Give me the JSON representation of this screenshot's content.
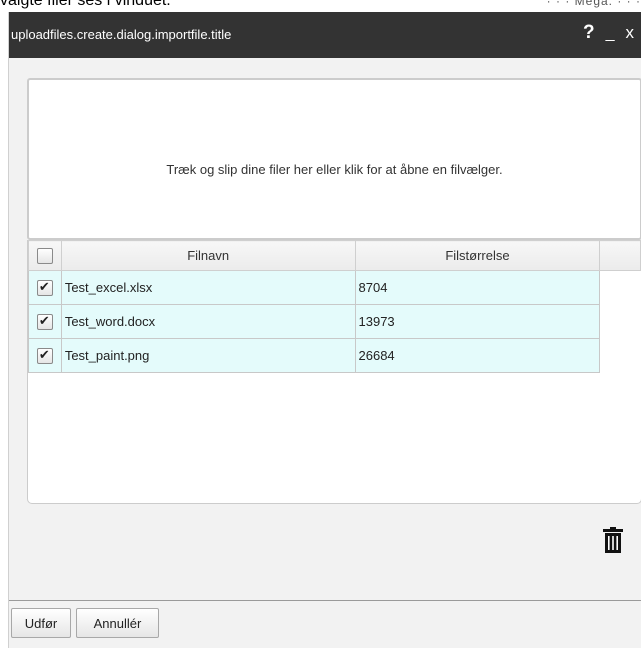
{
  "background": {
    "text": "valgte filer ses i vinduet.",
    "right_fragment": "· · · Mega. · · ·"
  },
  "dialog": {
    "title": "uploadfiles.create.dialog.importfile.title",
    "controls": {
      "help": "?",
      "minimize": "_",
      "close": "x"
    }
  },
  "dropzone": {
    "message": "Træk og slip dine filer her eller klik for at åbne en filvælger."
  },
  "file_table": {
    "headers": {
      "name": "Filnavn",
      "size": "Filstørrelse"
    },
    "rows": [
      {
        "checked": true,
        "name": "Test_excel.xlsx",
        "size": "8704"
      },
      {
        "checked": true,
        "name": "Test_word.docx",
        "size": "13973"
      },
      {
        "checked": true,
        "name": "Test_paint.png",
        "size": "26684"
      }
    ]
  },
  "footer": {
    "ok_label": "Udfør",
    "cancel_label": "Annullér"
  },
  "colors": {
    "titlebar": "#333333",
    "row_bg": "#e4fbfb",
    "dialog_bg": "#f2f2f2"
  },
  "icons": {
    "delete": "trash-icon"
  }
}
